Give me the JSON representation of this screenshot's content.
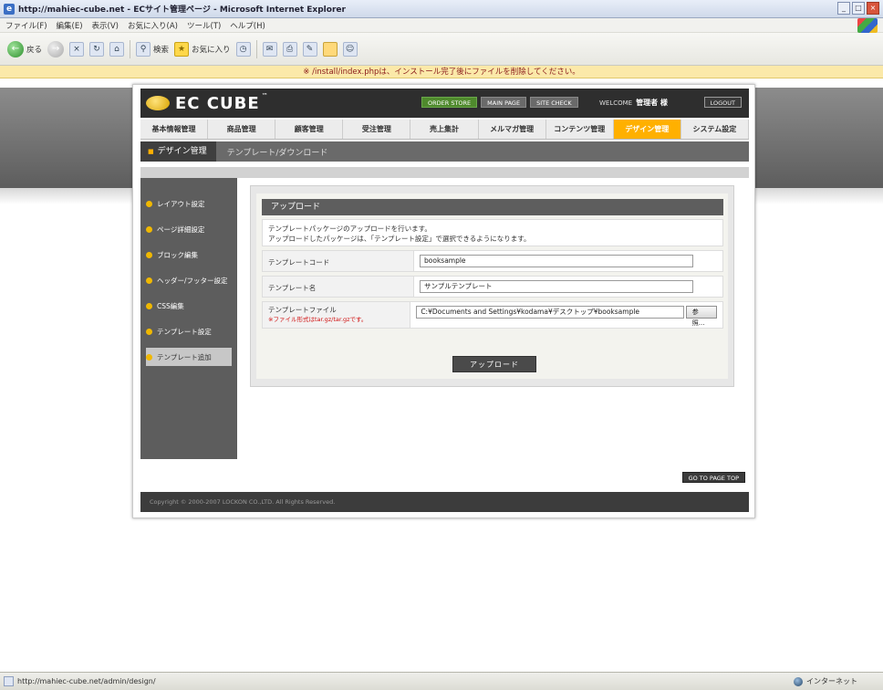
{
  "browser": {
    "title": "http://mahiec-cube.net - ECサイト管理ページ - Microsoft Internet Explorer",
    "menu": [
      "ファイル(F)",
      "編集(E)",
      "表示(V)",
      "お気に入り(A)",
      "ツール(T)",
      "ヘルプ(H)"
    ],
    "toolbar": {
      "back": "戻る",
      "search": "検索",
      "favorites": "お気に入り"
    },
    "info_bar": "※ /install/index.phpは、インストール完了後にファイルを削除してください。",
    "status_url": "http://mahiec-cube.net/admin/design/",
    "status_zone": "インターネット"
  },
  "app": {
    "logo": "EC CUBE",
    "tm": "™",
    "header_buttons": [
      "ORDER STORE",
      "MAIN PAGE",
      "SITE CHECK"
    ],
    "welcome_label": "WELCOME",
    "user": "管理者 様",
    "logout": "LOGOUT",
    "nav": [
      "基本情報管理",
      "商品管理",
      "顧客管理",
      "受注管理",
      "売上集計",
      "メルマガ管理",
      "コンテンツ管理",
      "デザイン管理",
      "システム設定"
    ],
    "category": "デザイン管理",
    "page_title": "テンプレート/ダウンロード",
    "sidebar": [
      "レイアウト設定",
      "ページ詳細設定",
      "ブロック編集",
      "ヘッダー/フッター設定",
      "CSS編集",
      "テンプレート設定",
      "テンプレート追加"
    ]
  },
  "form": {
    "title": "アップロード",
    "desc1": "テンプレートパッケージのアップロードを行います。",
    "desc2": "アップロードしたパッケージは、「テンプレート設定」で選択できるようになります。",
    "code_label": "テンプレートコード",
    "code_value": "booksample",
    "name_label": "テンプレート名",
    "name_value": "サンプルテンプレート",
    "file_label": "テンプレートファイル",
    "file_note": "※ファイル形式はtar.gz/tar.gzです。",
    "file_value": "C:¥Documents and Settings¥kodama¥デスクトップ¥booksample",
    "browse": "参照...",
    "upload_button": "アップロード"
  },
  "page_top": "GO TO PAGE TOP",
  "footer": "Copyright © 2000-2007 LOCKON CO.,LTD. All Rights Reserved."
}
